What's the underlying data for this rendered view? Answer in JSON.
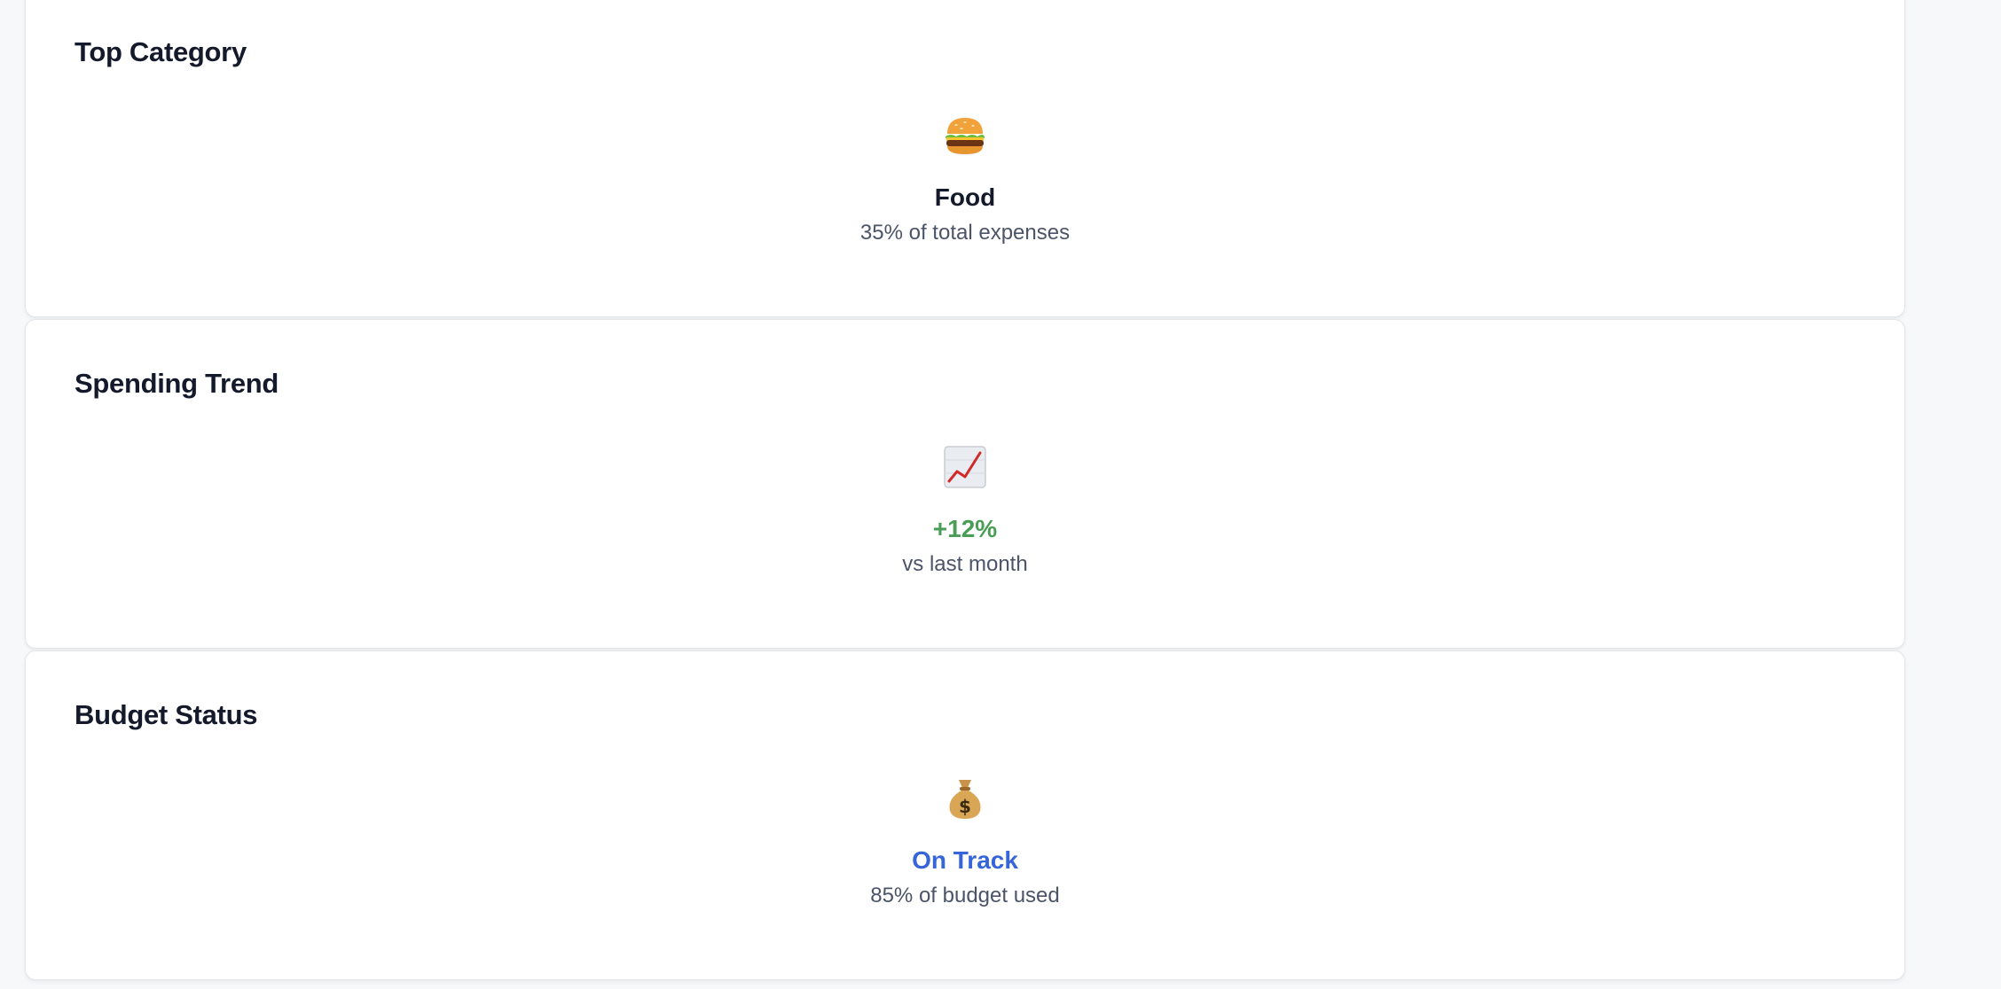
{
  "cards": [
    {
      "title": "Top Category",
      "icon": "hamburger-icon",
      "value": "Food",
      "subtext": "35% of total expenses"
    },
    {
      "title": "Spending Trend",
      "icon": "chart-increasing-icon",
      "value": "+12%",
      "subtext": "vs last month",
      "value_color": "#4a9d55"
    },
    {
      "title": "Budget Status",
      "icon": "money-bag-icon",
      "value": "On Track",
      "subtext": "85% of budget used",
      "value_color": "#3565d8"
    }
  ]
}
